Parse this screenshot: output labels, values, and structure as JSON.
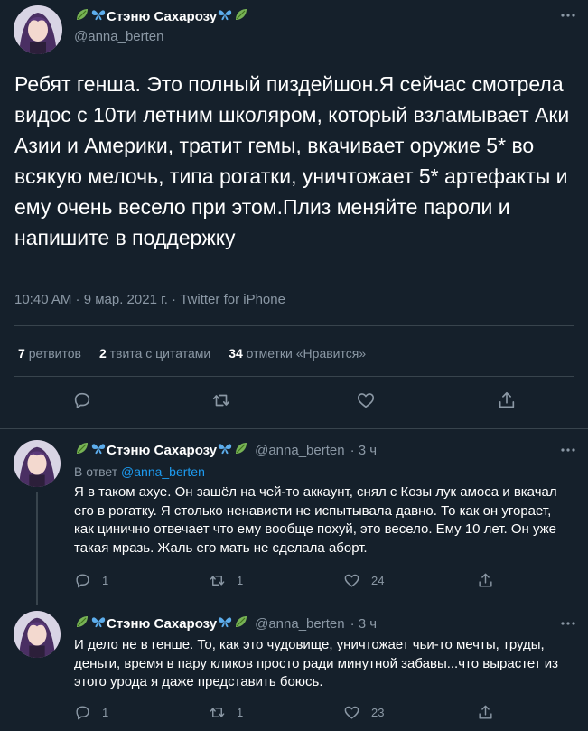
{
  "main_tweet": {
    "display_name": "Стэню Сахарозу",
    "handle": "@anna_berten",
    "text": "Ребят генша. Это полный пиздейшон.Я сейчас смотрела видос с 10ти летним школяром, который взламывает Аки Азии и Америки, тратит гемы, вкачивает оружие 5* во всякую мелочь, типа рогатки, уничтожает 5* артефакты и ему очень весело при этом.Плиз меняйте пароли и напишите в поддержку",
    "timestamp": "10:40 AM · 9 мар. 2021 г. · Twitter for iPhone",
    "retweets_count": "7",
    "retweets_label": "ретвитов",
    "quotes_count": "2",
    "quotes_label": "твита с цитатами",
    "likes_count": "34",
    "likes_label": "отметки «Нравится»"
  },
  "replies": [
    {
      "display_name": "Стэню Сахарозу",
      "handle": "@anna_berten",
      "time": "· 3 ч",
      "reply_to_label": "В ответ",
      "reply_to_handle": "@anna_berten",
      "text": "Я в таком ахуе. Он зашёл на чей-то аккаунт, снял с Козы лук амоса и вкачал его в рогатку. Я столько ненависти не испытывала давно. То как он угорает, как цинично отвечает что ему вообще похуй, это весело. Ему 10 лет. Он уже такая мразь. Жаль его мать не сделала аборт.",
      "replies": "1",
      "retweets": "1",
      "likes": "24"
    },
    {
      "display_name": "Стэню Сахарозу",
      "handle": "@anna_berten",
      "time": "· 3 ч",
      "text": "И дело не в генше. То, как это чудовище, уничтожает чьи-то мечты, труды, деньги, время в пару кликов просто ради минутной забавы...что вырастет из этого урода я даже представить боюсь.",
      "replies": "1",
      "retweets": "1",
      "likes": "23"
    }
  ],
  "colors": {
    "background": "#15202b",
    "secondary_text": "#8b98a5",
    "link": "#1d9bf0",
    "divider": "#38444d"
  }
}
